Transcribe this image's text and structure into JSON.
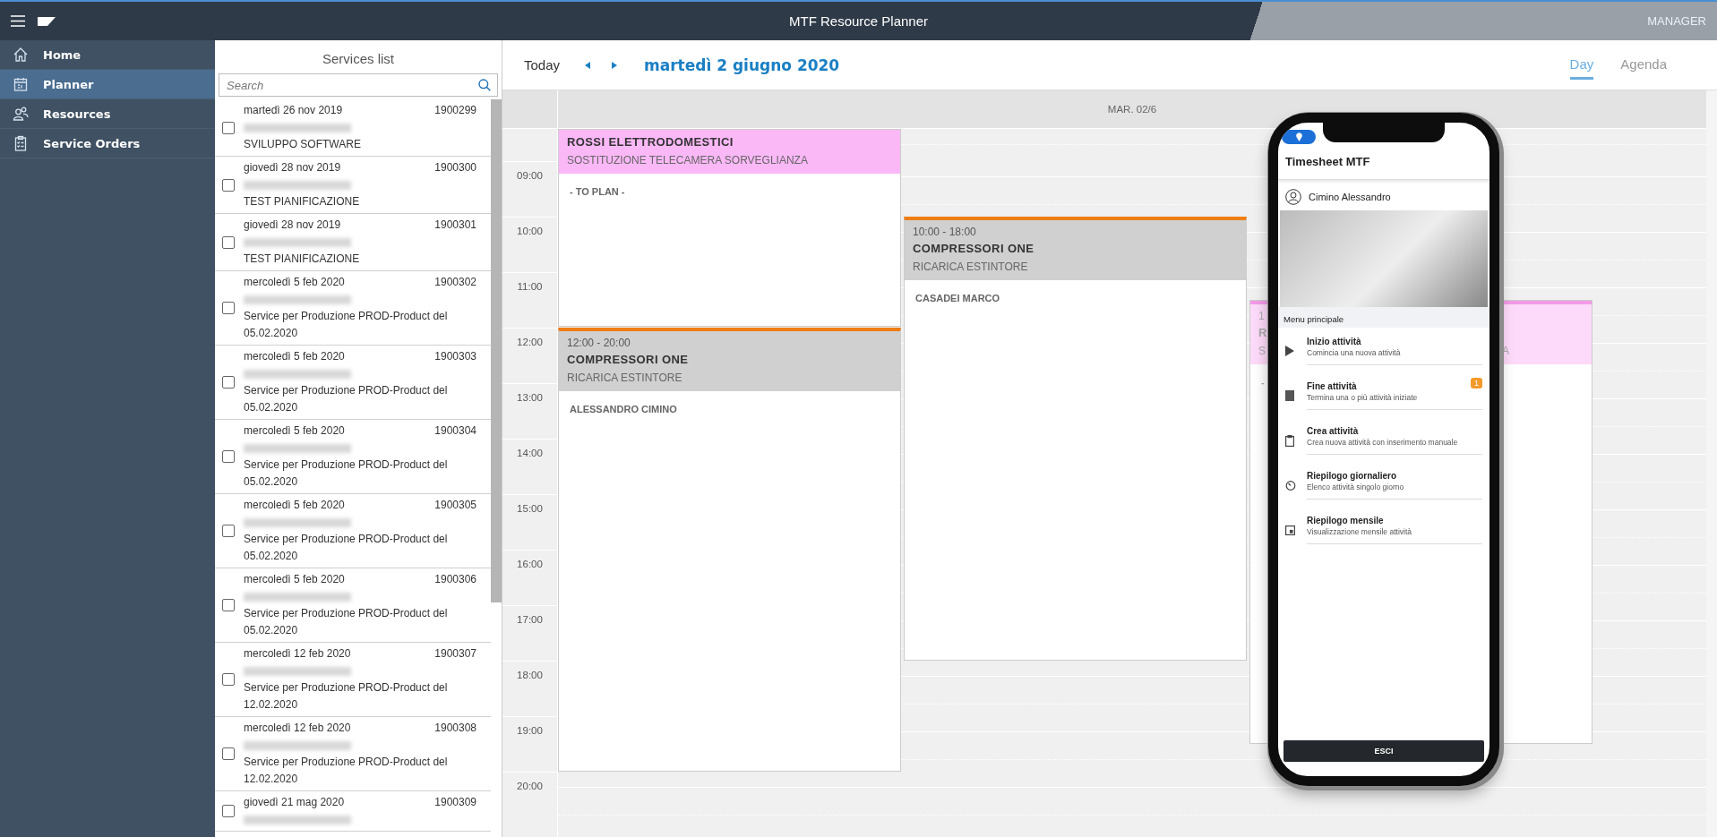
{
  "header": {
    "title": "MTF Resource Planner",
    "role": "MANAGER"
  },
  "sidebar": {
    "items": [
      {
        "label": "Home",
        "selected": false
      },
      {
        "label": "Planner",
        "selected": true
      },
      {
        "label": "Resources",
        "selected": false
      },
      {
        "label": "Service Orders",
        "selected": false
      }
    ]
  },
  "services": {
    "title": "Services list",
    "search": {
      "placeholder": "Search"
    },
    "rows": [
      {
        "date": "martedì 26 nov 2019",
        "number": "1900299",
        "description": "SVILUPPO SOFTWARE",
        "checked": false
      },
      {
        "date": "giovedì 28 nov 2019",
        "number": "1900300",
        "description": "TEST PIANIFICAZIONE",
        "checked": false
      },
      {
        "date": "giovedì 28 nov 2019",
        "number": "1900301",
        "description": "TEST PIANIFICAZIONE",
        "checked": false
      },
      {
        "date": "mercoledì 5 feb 2020",
        "number": "1900302",
        "description": "Service per Produzione PROD-Product del 05.02.2020",
        "checked": false
      },
      {
        "date": "mercoledì 5 feb 2020",
        "number": "1900303",
        "description": "Service per Produzione PROD-Product del 05.02.2020",
        "checked": false
      },
      {
        "date": "mercoledì 5 feb 2020",
        "number": "1900304",
        "description": "Service per Produzione PROD-Product del 05.02.2020",
        "checked": false
      },
      {
        "date": "mercoledì 5 feb 2020",
        "number": "1900305",
        "description": "Service per Produzione PROD-Product del 05.02.2020",
        "checked": false
      },
      {
        "date": "mercoledì 5 feb 2020",
        "number": "1900306",
        "description": "Service per Produzione PROD-Product del 05.02.2020",
        "checked": false
      },
      {
        "date": "mercoledì 12 feb 2020",
        "number": "1900307",
        "description": "Service per Produzione PROD-Product del 12.02.2020",
        "checked": false
      },
      {
        "date": "mercoledì 12 feb 2020",
        "number": "1900308",
        "description": "Service per Produzione PROD-Product del 12.02.2020",
        "checked": false
      },
      {
        "date": "giovedì 21 mag 2020",
        "number": "1900309",
        "checked": false
      }
    ]
  },
  "toolbar": {
    "today": "Today",
    "date": "martedì 2 giugno 2020",
    "views": [
      {
        "label": "Day",
        "selected": true
      },
      {
        "label": "Agenda",
        "selected": false
      }
    ]
  },
  "calendar": {
    "day_header": "MAR. 02/6",
    "hours": [
      "09:00",
      "10:00",
      "11:00",
      "12:00",
      "13:00",
      "14:00",
      "15:00",
      "16:00",
      "17:00",
      "18:00",
      "19:00",
      "20:00"
    ],
    "events": [
      {
        "kind": "unplanned",
        "title": "ROSSI ELETTRODOMESTICI",
        "subtitle": "SOSTITUZIONE TELECAMERA SORVEGLIANZA",
        "assignee": "- TO PLAN -"
      },
      {
        "kind": "planned",
        "time": "12:00 - 20:00",
        "title": "COMPRESSORI ONE",
        "subtitle": "RICARICA ESTINTORE",
        "assignee": "ALESSANDRO CIMINO"
      },
      {
        "kind": "planned",
        "time": "10:00 - 18:00",
        "title": "COMPRESSORI ONE",
        "subtitle": "RICARICA ESTINTORE",
        "assignee": "CASADEI MARCO"
      },
      {
        "kind": "unplanned",
        "time": "1",
        "title": "R",
        "subtitle": "S",
        "subtitle_end": "A",
        "assignee": "-"
      }
    ]
  },
  "phone": {
    "title": "Timesheet MTF",
    "user": "Cimino Alessandro",
    "menu_title": "Menu principale",
    "menu": [
      {
        "title": "Inizio attività",
        "subtitle": "Comincia una nuova attività"
      },
      {
        "title": "Fine attività",
        "subtitle": "Termina una o più attività iniziate",
        "badge": "1"
      },
      {
        "title": "Crea attività",
        "subtitle": "Crea nuova attività con inserimento manuale"
      },
      {
        "title": "Riepilogo giornaliero",
        "subtitle": "Elenco attività singolo giorno"
      },
      {
        "title": "Riepilogo mensile",
        "subtitle": "Visualizzazione mensile attività"
      }
    ],
    "exit": "ESCI"
  }
}
